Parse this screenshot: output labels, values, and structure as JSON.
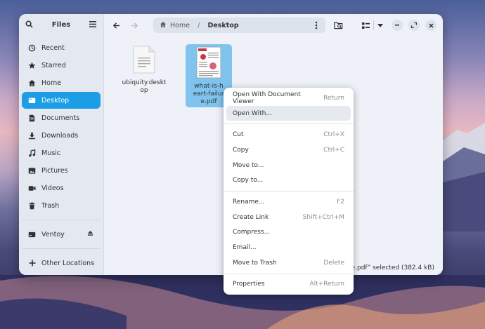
{
  "sidebar": {
    "title": "Files",
    "items": [
      {
        "label": "Recent",
        "icon": "clock-icon"
      },
      {
        "label": "Starred",
        "icon": "star-icon"
      },
      {
        "label": "Home",
        "icon": "home-icon"
      },
      {
        "label": "Desktop",
        "icon": "desktop-icon",
        "active": true
      },
      {
        "label": "Documents",
        "icon": "document-icon"
      },
      {
        "label": "Downloads",
        "icon": "download-icon"
      },
      {
        "label": "Music",
        "icon": "music-icon"
      },
      {
        "label": "Pictures",
        "icon": "picture-icon"
      },
      {
        "label": "Videos",
        "icon": "video-icon"
      },
      {
        "label": "Trash",
        "icon": "trash-icon"
      }
    ],
    "devices": [
      {
        "label": "Ventoy",
        "icon": "drive-icon"
      }
    ],
    "other": {
      "label": "Other Locations",
      "icon": "plus-icon"
    }
  },
  "pathbar": {
    "home": "Home",
    "separator": "/",
    "current": "Desktop"
  },
  "files": [
    {
      "name": "ubiquity.desktop",
      "icon": "text-file-icon"
    },
    {
      "name": "what-is-heart-failure.pdf",
      "icon": "pdf-thumbnail-icon",
      "selected": true
    }
  ],
  "status": "“what-is-heart-failure.pdf” selected  (382.4 kB)",
  "status_visible": "e.pdf” selected  (382.4 kB)",
  "context_menu": {
    "groups": [
      [
        {
          "label": "Open With Document Viewer",
          "accel": "Return"
        },
        {
          "label": "Open With...",
          "accel": "",
          "hover": true
        }
      ],
      [
        {
          "label": "Cut",
          "accel": "Ctrl+X"
        },
        {
          "label": "Copy",
          "accel": "Ctrl+C"
        },
        {
          "label": "Move to...",
          "accel": ""
        },
        {
          "label": "Copy to...",
          "accel": ""
        }
      ],
      [
        {
          "label": "Rename...",
          "accel": "F2"
        },
        {
          "label": "Create Link",
          "accel": "Shift+Ctrl+M"
        },
        {
          "label": "Compress...",
          "accel": ""
        },
        {
          "label": "Email...",
          "accel": ""
        },
        {
          "label": "Move to Trash",
          "accel": "Delete"
        }
      ],
      [
        {
          "label": "Properties",
          "accel": "Alt+Return"
        }
      ]
    ]
  },
  "colors": {
    "accent": "#1c9ee6",
    "selection": "#7fc4ef"
  }
}
